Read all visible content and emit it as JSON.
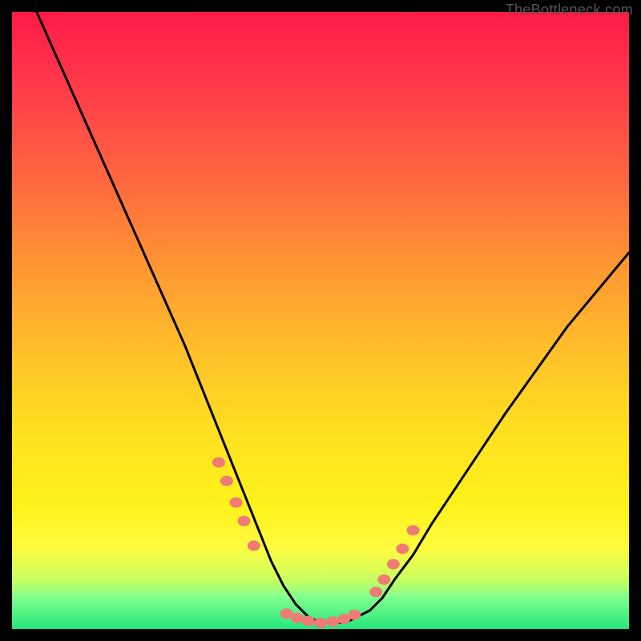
{
  "watermark": "TheBottleneck.com",
  "colors": {
    "curve_stroke": "#000000",
    "marker_fill": "#ef7b74",
    "marker_stroke": "#ef7b74",
    "background_frame": "#000000",
    "gradient_top": "#ff1a46",
    "gradient_bottom": "#25e67a"
  },
  "chart_data": {
    "type": "line",
    "title": "",
    "xlabel": "",
    "ylabel": "",
    "xlim": [
      0,
      100
    ],
    "ylim": [
      0,
      100
    ],
    "series": [
      {
        "name": "bottleneck-curve",
        "x": [
          4,
          8,
          12,
          16,
          20,
          24,
          28,
          30,
          32,
          34,
          36,
          38,
          40,
          42,
          44,
          46,
          48,
          50,
          52,
          54,
          56,
          58,
          60,
          62,
          65,
          68,
          72,
          76,
          80,
          85,
          90,
          95,
          100
        ],
        "y": [
          100,
          91,
          82,
          73,
          64,
          55,
          46,
          41,
          36,
          31,
          26,
          21,
          16,
          11,
          7,
          4,
          2,
          1,
          1,
          1,
          2,
          3,
          5,
          8,
          12,
          17,
          23,
          29,
          35,
          42,
          49,
          55,
          61
        ]
      }
    ],
    "markers": {
      "left_cluster": {
        "x": [
          33.5,
          34.8,
          36.3,
          37.6,
          39.2
        ],
        "y": [
          27,
          24,
          20.5,
          17.5,
          13.5
        ]
      },
      "bottom_cluster": {
        "x": [
          44.5,
          46.2,
          48.0,
          50.0,
          52.0,
          53.8,
          55.5
        ],
        "y": [
          2.5,
          1.8,
          1.3,
          1.0,
          1.2,
          1.6,
          2.3
        ]
      },
      "right_cluster": {
        "x": [
          59.0,
          60.3,
          61.8,
          63.3,
          65.0
        ],
        "y": [
          6.0,
          8.0,
          10.5,
          13.0,
          16.0
        ]
      }
    }
  }
}
